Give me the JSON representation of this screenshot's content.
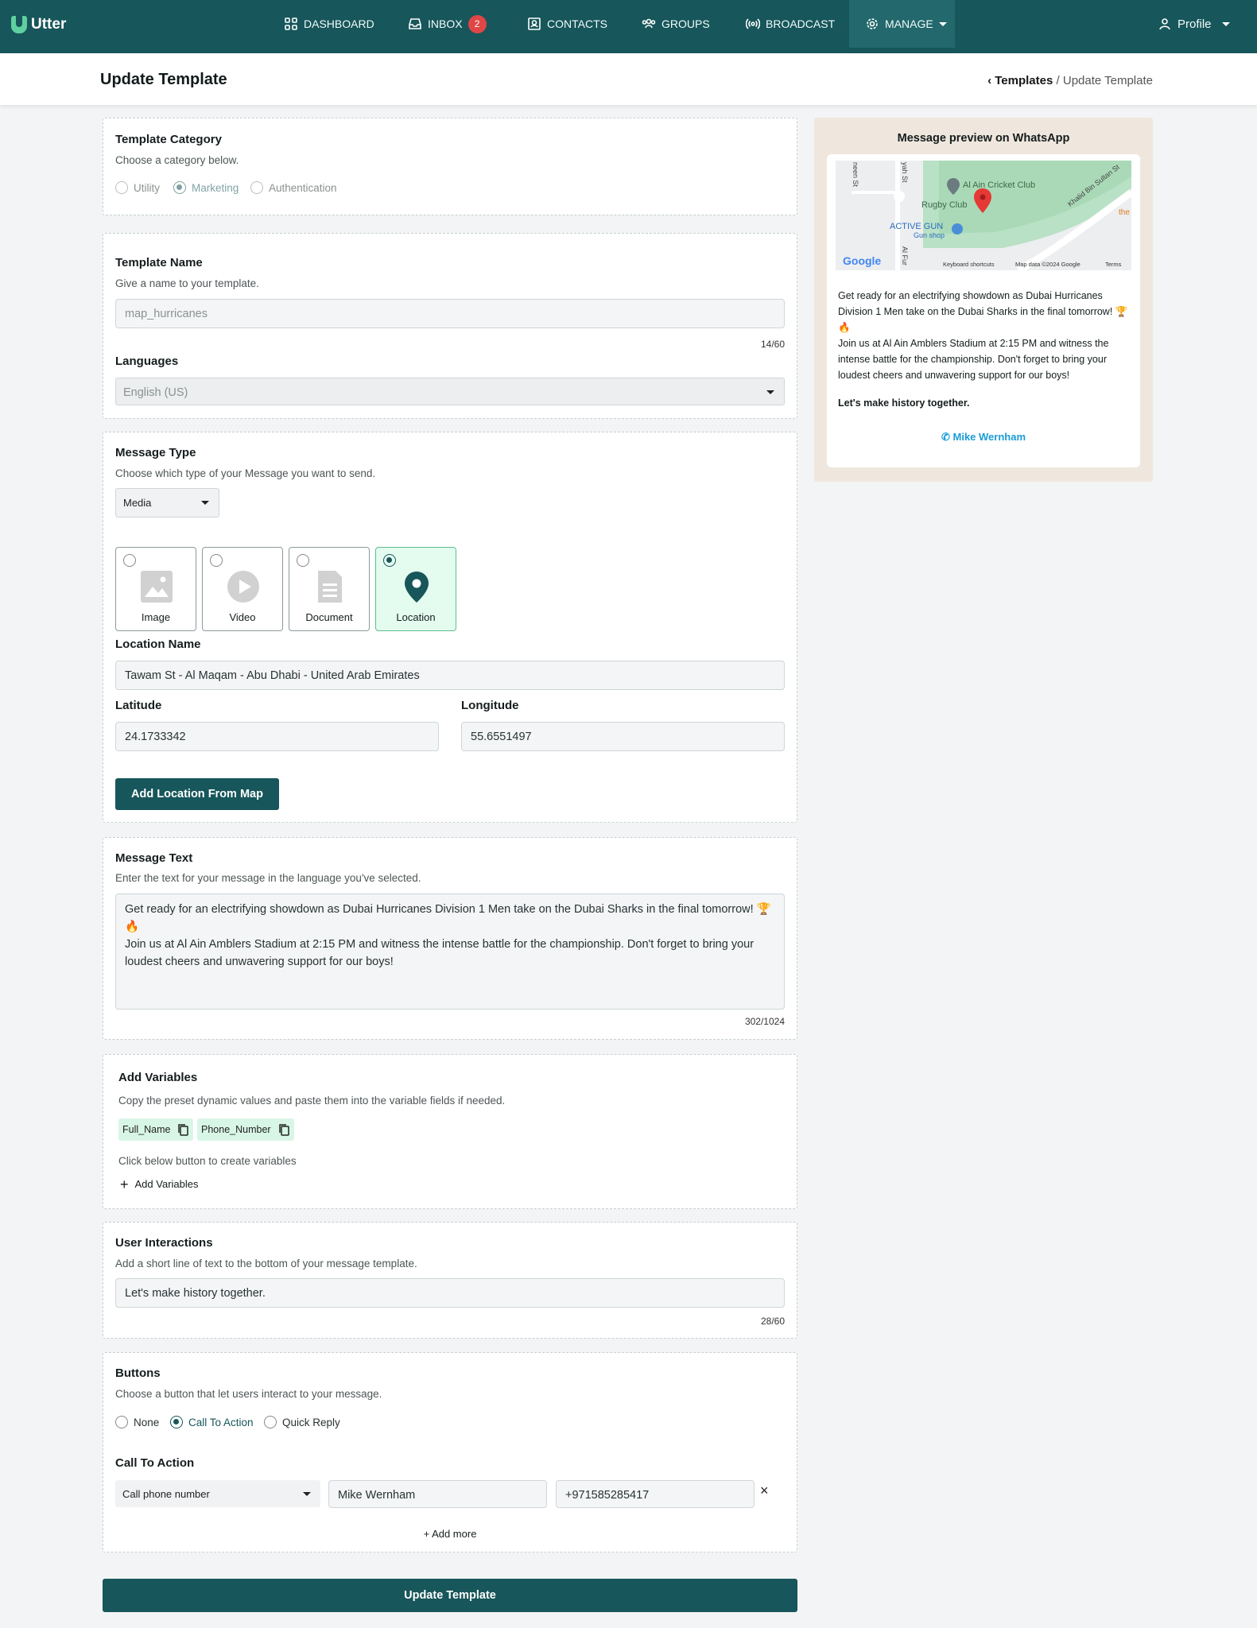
{
  "nav": {
    "brand": "Utter",
    "items": [
      {
        "label": "DASHBOARD",
        "icon": "grid-icon"
      },
      {
        "label": "INBOX",
        "icon": "inbox-icon",
        "badge": "2"
      },
      {
        "label": "CONTACTS",
        "icon": "contacts-icon"
      },
      {
        "label": "GROUPS",
        "icon": "groups-icon"
      },
      {
        "label": "BROADCAST",
        "icon": "broadcast-icon"
      },
      {
        "label": "MANAGE",
        "icon": "gear-icon"
      }
    ],
    "profile": "Profile"
  },
  "header": {
    "title": "Update Template",
    "breadcrumb_link": "Templates",
    "breadcrumb_sep": " / ",
    "breadcrumb_current": "Update Template"
  },
  "category": {
    "title": "Template Category",
    "subtitle": "Choose a category below.",
    "options": [
      "Utility",
      "Marketing",
      "Authentication"
    ],
    "selected": "Marketing"
  },
  "name": {
    "title": "Template Name",
    "subtitle": "Give a name to your template.",
    "value": "map_hurricanes",
    "counter": "14/60",
    "languages_label": "Languages",
    "language_value": "English (US)"
  },
  "message_type": {
    "title": "Message Type",
    "subtitle": "Choose which type of your Message you want to send.",
    "select_value": "Media",
    "cards": [
      "Image",
      "Video",
      "Document",
      "Location"
    ],
    "selected": "Location",
    "location_name_label": "Location Name",
    "location_name": "Tawam St - Al Maqam - Abu Dhabi - United Arab Emirates",
    "latitude_label": "Latitude",
    "latitude": "24.1733342",
    "longitude_label": "Longitude",
    "longitude": "55.6551497",
    "add_map_button": "Add Location From Map"
  },
  "message_text": {
    "title": "Message Text",
    "subtitle": "Enter the text for your message in the language you've selected.",
    "body": "Get ready for an electrifying showdown as Dubai Hurricanes Division 1 Men take on the Dubai Sharks in the final tomorrow! 🏆🔥\nJoin us at Al Ain Amblers Stadium at 2:15 PM and witness the intense battle for the championship. Don't forget to bring your loudest cheers and unwavering support for our boys!",
    "counter": "302/1024"
  },
  "variables": {
    "title": "Add Variables",
    "subtitle": "Copy the preset dynamic values and paste them into the variable fields if needed.",
    "chips": [
      "Full_Name",
      "Phone_Number"
    ],
    "hint": "Click below button to create variables",
    "add_label": "Add Variables"
  },
  "interactions": {
    "title": "User Interactions",
    "subtitle": "Add a short line of text to the bottom of your message template.",
    "value": "Let's make history together.",
    "counter": "28/60"
  },
  "buttons": {
    "title": "Buttons",
    "subtitle": "Choose a button that let users interact to your message.",
    "options": [
      "None",
      "Call To Action",
      "Quick Reply"
    ],
    "selected": "Call To Action",
    "cta_title": "Call To Action",
    "cta_type": "Call phone number",
    "cta_text": "Mike Wernham",
    "cta_phone": "+971585285417",
    "add_more": "Add more"
  },
  "submit": "Update Template",
  "preview": {
    "title": "Message preview on WhatsApp",
    "map_labels": [
      "Al Ain Cricket Club",
      "Rugby Club",
      "ACTIVE GUN",
      "Gun shop",
      "Khalid Bin Sultan St",
      "Keyboard shortcuts",
      "Map data ©2024 Google",
      "Terms",
      "Google",
      "the",
      "yah St",
      "neen St",
      "Al Fur"
    ],
    "message": "Get ready for an electrifying showdown as Dubai Hurricanes Division 1 Men take on the Dubai Sharks in the final tomorrow! 🏆🔥\nJoin us at Al Ain Amblers Stadium at 2:15 PM and witness the intense battle for the championship. Don't forget to bring your loudest cheers and unwavering support for our boys!",
    "footer": "Let's make history together.",
    "cta": "Mike Wernham"
  },
  "colors": {
    "brand": "#17565a",
    "accent": "#5fd0a1",
    "badge": "#e04646",
    "link": "#1a9dd7"
  }
}
